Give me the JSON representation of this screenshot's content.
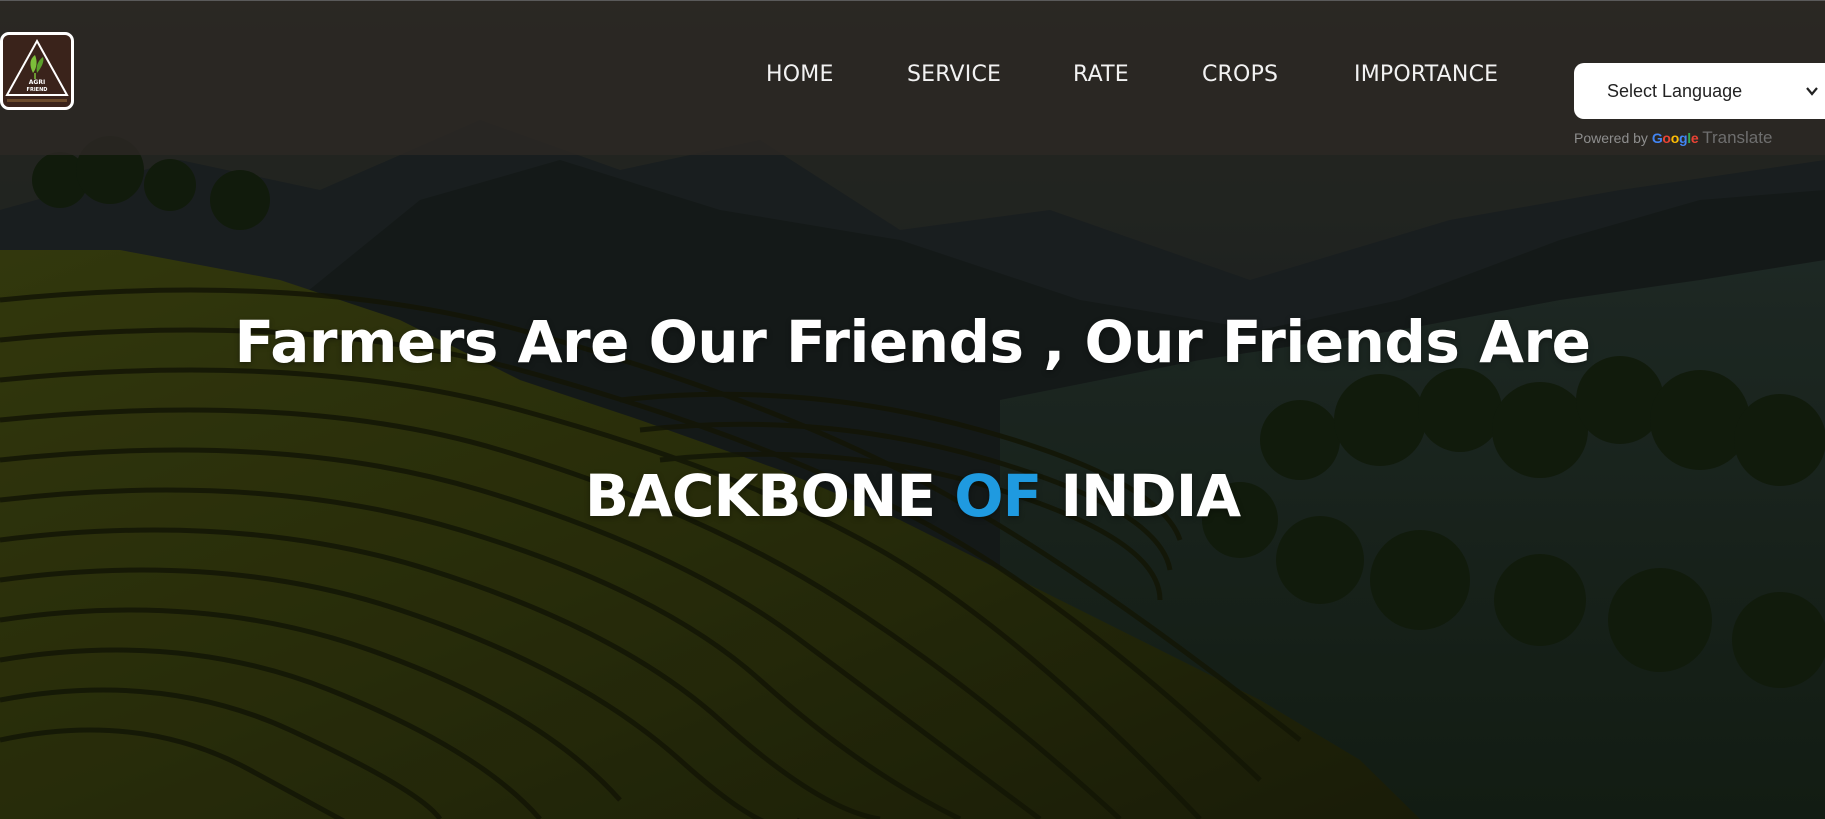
{
  "logo": {
    "line1": "AGRI",
    "line2": "FRIEND"
  },
  "nav": {
    "items": [
      {
        "label": "HOME"
      },
      {
        "label": "SERVICE"
      },
      {
        "label": "RATE"
      },
      {
        "label": "CROPS"
      },
      {
        "label": "IMPORTANCE"
      }
    ]
  },
  "translate": {
    "select_label": "Select Language",
    "powered_by": "Powered by",
    "google": "Google",
    "translate_word": "Translate"
  },
  "hero": {
    "line1": "Farmers Are Our Friends , Our Friends Are",
    "line2_part1": "BACKBONE",
    "line2_accent": "OF",
    "line2_part2": "INDIA"
  },
  "colors": {
    "accent": "#1f9ae0",
    "header": "#2c2824",
    "text": "#ffffff"
  }
}
